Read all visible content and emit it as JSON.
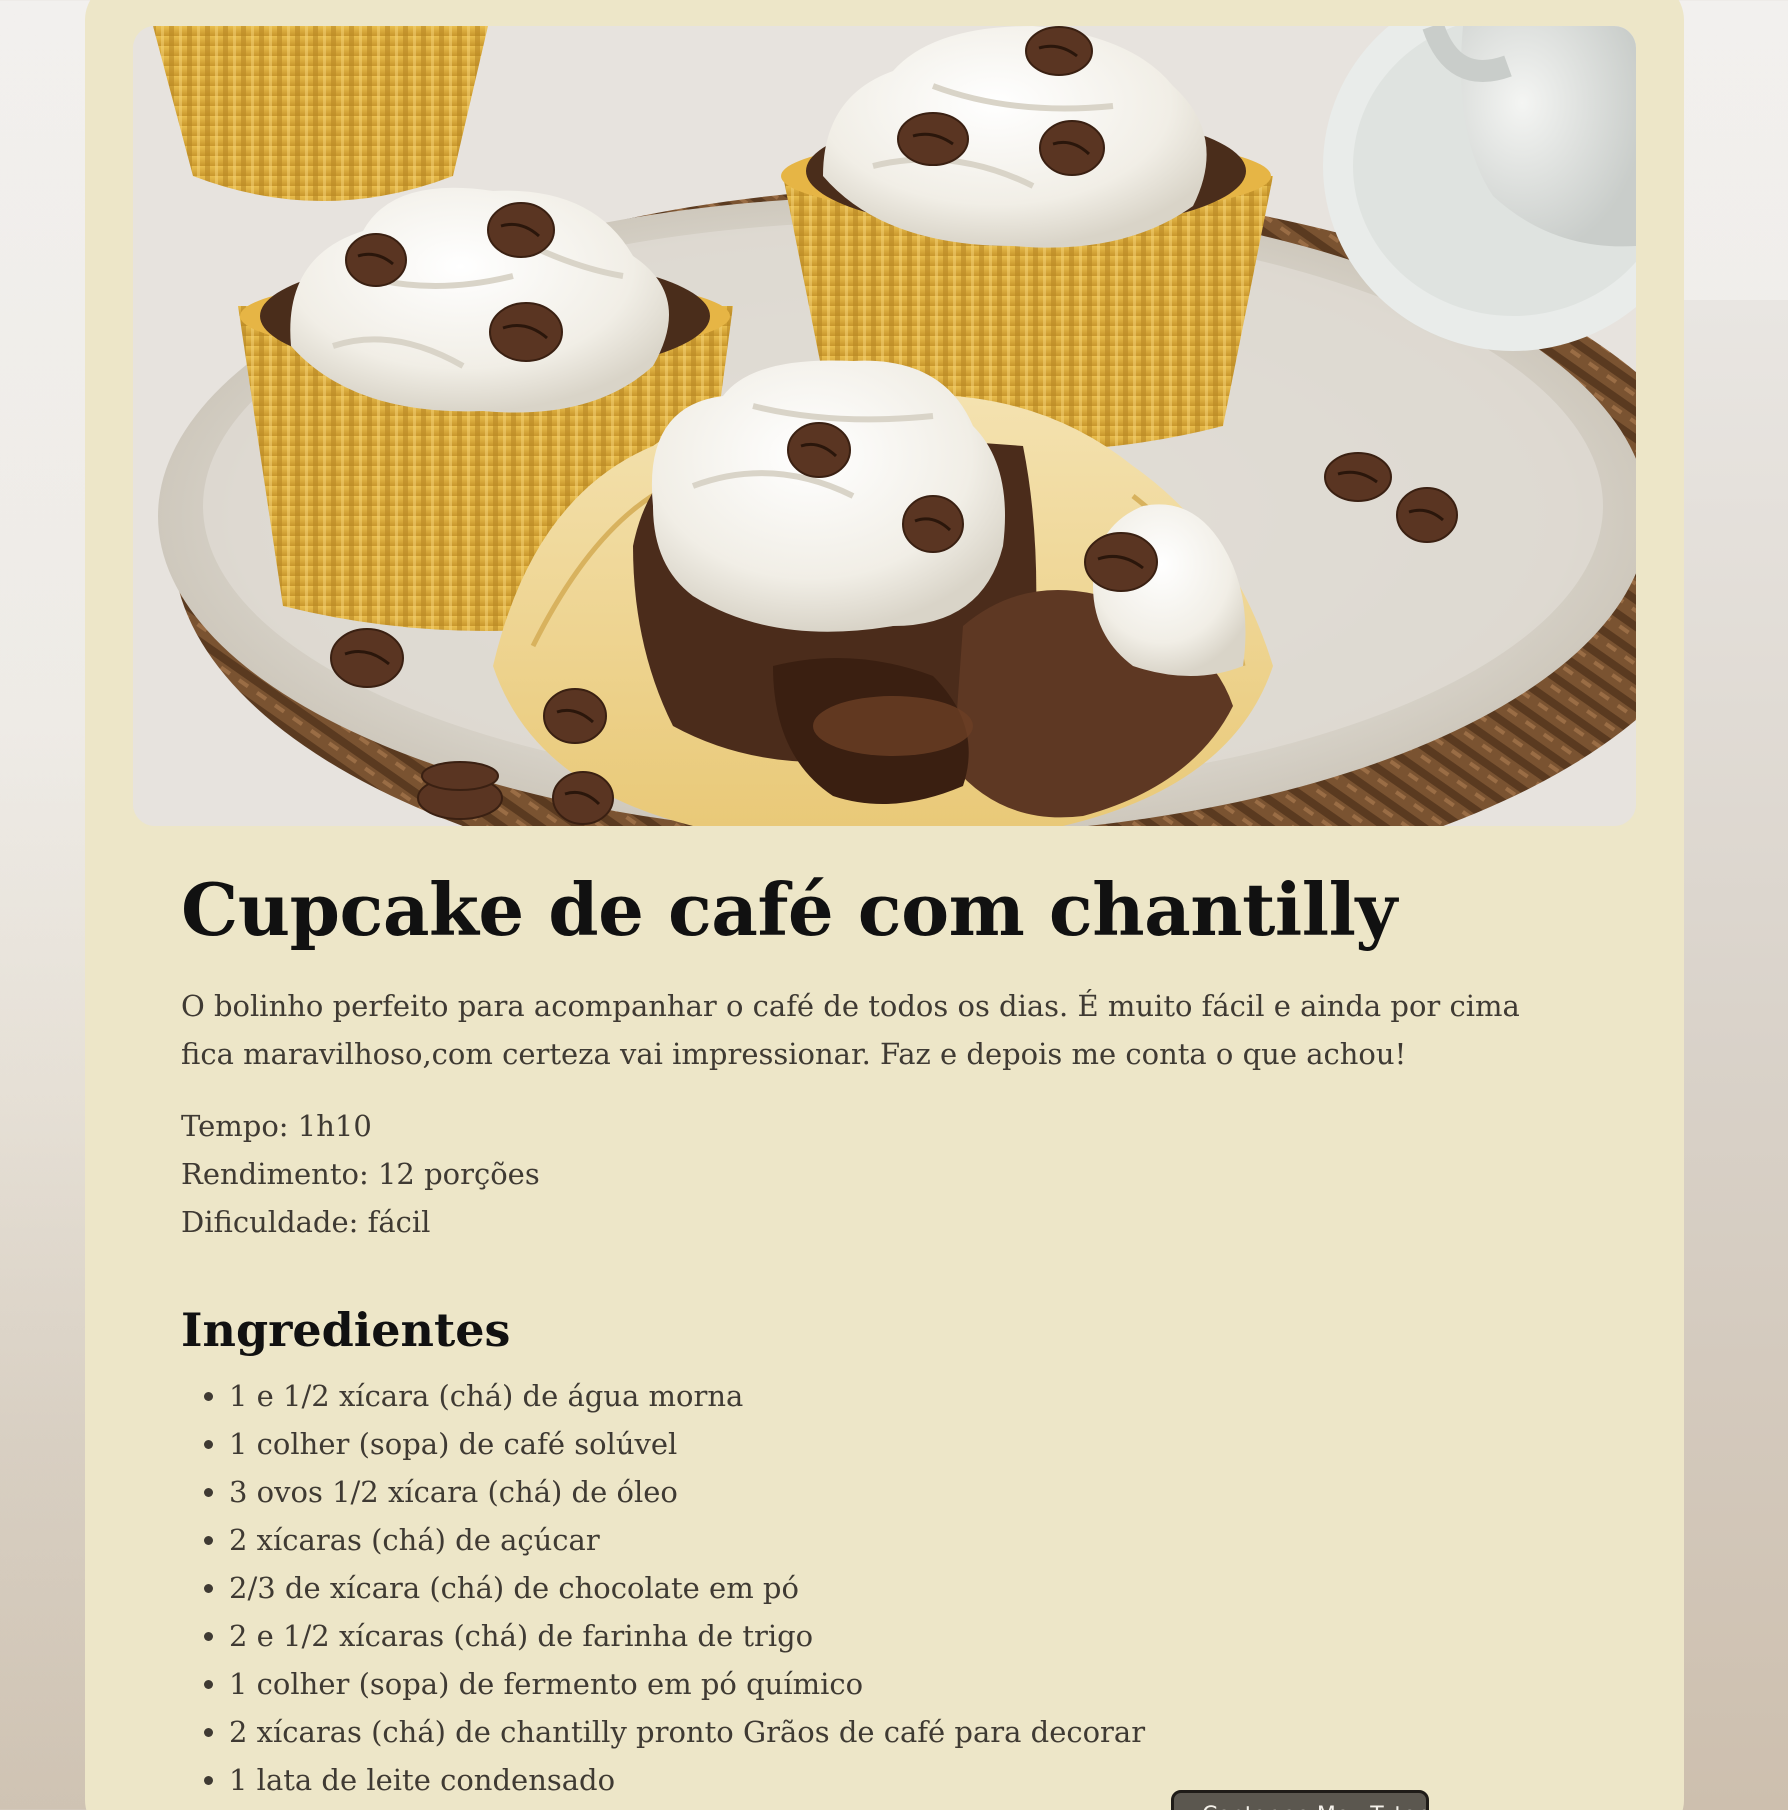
{
  "recipe": {
    "image_alt": "Cupcakes de café com chantilly e grãos de café",
    "title": "Cupcake de café com chantilly",
    "description": "O bolinho perfeito para acompanhar o café de todos os dias. É muito fácil e ainda por cima fica maravilhoso,com certeza vai impressionar. Faz e depois me conta o que achou!",
    "meta": {
      "time": "Tempo: 1h10",
      "yield": "Rendimento: 12 porções",
      "difficulty": "Dificuldade: fácil"
    },
    "ingredients_heading": "Ingredientes",
    "ingredients": [
      "1 e 1/2 xícara (chá) de água morna",
      "1 colher (sopa) de café solúvel",
      "3 ovos 1/2 xícara (chá) de óleo",
      "2 xícaras (chá) de açúcar",
      "2/3 de xícara (chá) de chocolate em pó",
      "2 e 1/2 xícaras (chá) de farinha de trigo",
      "1 colher (sopa) de fermento em pó químico",
      "2 xícaras (chá) de chantilly pronto Grãos de café para decorar",
      "1 lata de leite condensado"
    ]
  },
  "floating_button": {
    "label": "Contar ao Meu Tutor"
  },
  "colors": {
    "card_background": "#ede6c8",
    "title_text": "#111111",
    "body_text": "#3f3a33",
    "button_background": "#5b574f"
  }
}
